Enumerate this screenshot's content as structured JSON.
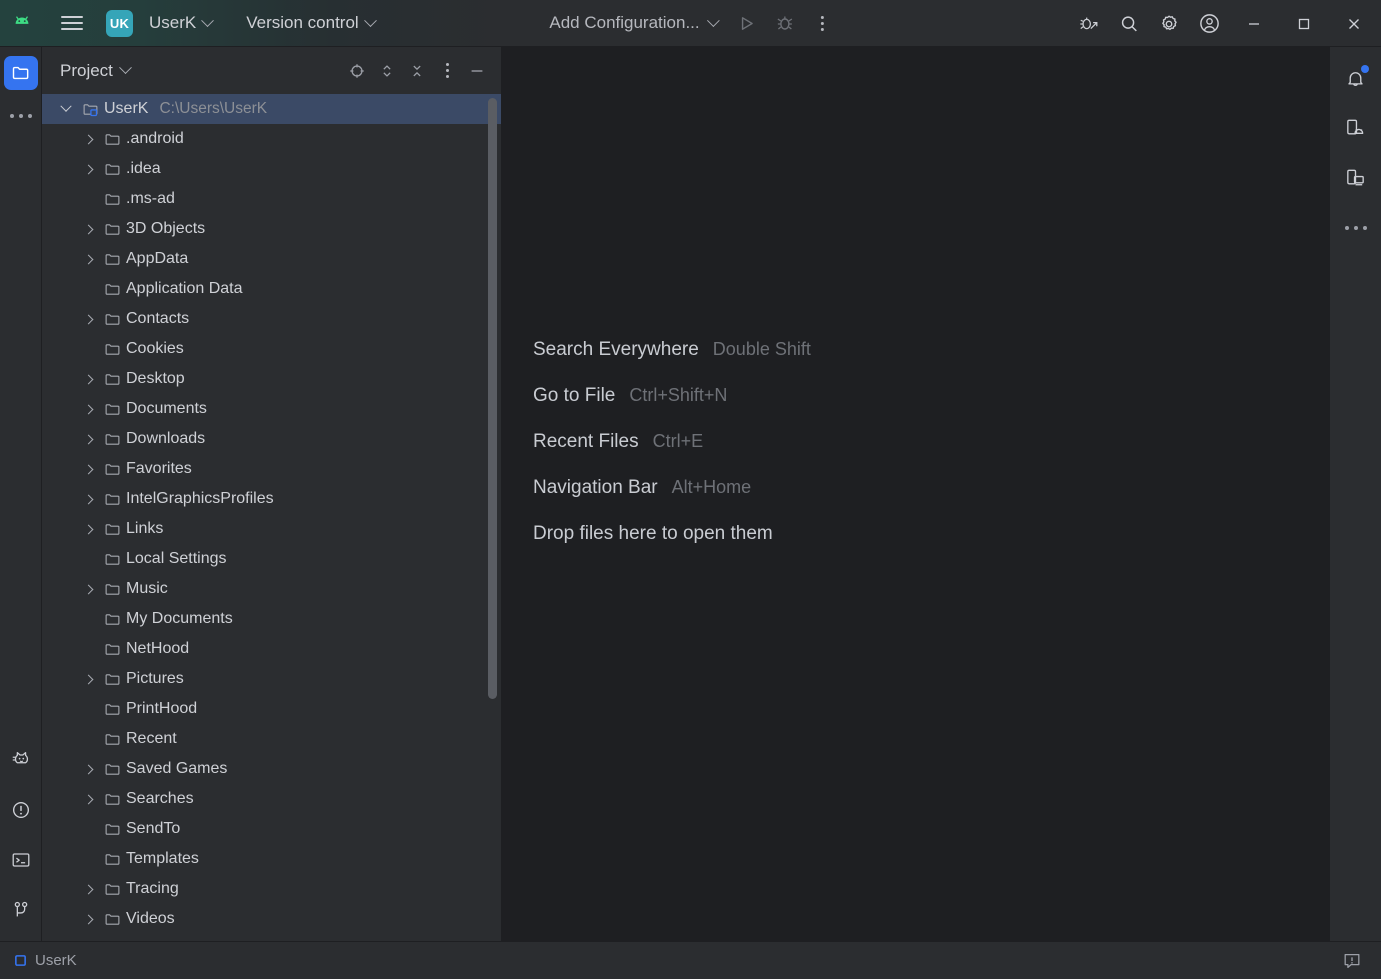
{
  "colors": {
    "accent_blue": "#3574F0",
    "selection_blue": "#3B4A66",
    "badge_teal": "#35A5B8",
    "panel_bg": "#2B2D30",
    "editor_bg": "#1E1F22",
    "text_primary": "#CFD1D6",
    "text_muted": "#8D9096",
    "android_green": "#3DDC84"
  },
  "titlebar": {
    "logo_icon": "android-studio-logo-icon",
    "menu_icon": "hamburger-menu-icon",
    "project_badge": "UK",
    "project_name": "UserK",
    "project_chevron_icon": "chevron-down-icon",
    "vcs_label": "Version control",
    "vcs_chevron_icon": "chevron-down-icon",
    "run_config_label": "Add Configuration...",
    "run_config_chevron_icon": "chevron-down-icon",
    "run_icon": "run-play-icon",
    "debug_icon": "debug-bug-icon",
    "more_icon": "more-vertical-icon",
    "app_inspection_icon": "bug-with-arrow-icon",
    "search_icon": "search-icon",
    "settings_icon": "gear-icon",
    "account_icon": "user-avatar-icon",
    "minimize_icon": "window-minimize-icon",
    "maximize_icon": "window-maximize-icon",
    "close_icon": "window-close-icon"
  },
  "left_stripe": {
    "top_items": [
      {
        "name": "project",
        "icon": "folder-icon",
        "active": true
      },
      {
        "name": "more",
        "icon": "more-horizontal-icon",
        "active": false
      }
    ],
    "bottom_items": [
      {
        "name": "logcat",
        "icon": "cat-logcat-icon"
      },
      {
        "name": "problems",
        "icon": "problems-warning-icon"
      },
      {
        "name": "terminal",
        "icon": "terminal-icon"
      },
      {
        "name": "version-control",
        "icon": "branch-icon"
      }
    ]
  },
  "right_stripe": {
    "items": [
      {
        "name": "notifications",
        "icon": "bell-icon",
        "badge": true
      },
      {
        "name": "device-manager",
        "icon": "device-manager-icon",
        "badge": false
      },
      {
        "name": "running-devices",
        "icon": "running-devices-icon",
        "badge": false
      },
      {
        "name": "more",
        "icon": "more-horizontal-icon",
        "badge": false
      }
    ]
  },
  "project_panel": {
    "title": "Project",
    "title_chevron_icon": "chevron-down-icon",
    "actions": [
      {
        "name": "select-opened-file",
        "icon": "crosshair-target-icon"
      },
      {
        "name": "expand-collapse",
        "icon": "chevron-up-down-icon"
      },
      {
        "name": "collapse-all",
        "icon": "collapse-all-icon"
      },
      {
        "name": "options",
        "icon": "more-vertical-icon"
      },
      {
        "name": "hide",
        "icon": "minimize-dash-icon"
      }
    ],
    "root": {
      "label": "UserK",
      "path": "C:\\Users\\UserK",
      "icon": "module-folder-icon",
      "expanded": true,
      "selected": true
    },
    "children": [
      {
        "label": ".android",
        "expandable": true
      },
      {
        "label": ".idea",
        "expandable": true
      },
      {
        "label": ".ms-ad",
        "expandable": false
      },
      {
        "label": "3D Objects",
        "expandable": true
      },
      {
        "label": "AppData",
        "expandable": true
      },
      {
        "label": "Application Data",
        "expandable": false
      },
      {
        "label": "Contacts",
        "expandable": true
      },
      {
        "label": "Cookies",
        "expandable": false
      },
      {
        "label": "Desktop",
        "expandable": true
      },
      {
        "label": "Documents",
        "expandable": true
      },
      {
        "label": "Downloads",
        "expandable": true
      },
      {
        "label": "Favorites",
        "expandable": true
      },
      {
        "label": "IntelGraphicsProfiles",
        "expandable": true
      },
      {
        "label": "Links",
        "expandable": true
      },
      {
        "label": "Local Settings",
        "expandable": false
      },
      {
        "label": "Music",
        "expandable": true
      },
      {
        "label": "My Documents",
        "expandable": false
      },
      {
        "label": "NetHood",
        "expandable": false
      },
      {
        "label": "Pictures",
        "expandable": true
      },
      {
        "label": "PrintHood",
        "expandable": false
      },
      {
        "label": "Recent",
        "expandable": false
      },
      {
        "label": "Saved Games",
        "expandable": true
      },
      {
        "label": "Searches",
        "expandable": true
      },
      {
        "label": "SendTo",
        "expandable": false
      },
      {
        "label": "Templates",
        "expandable": false
      },
      {
        "label": "Tracing",
        "expandable": true
      },
      {
        "label": "Videos",
        "expandable": true
      }
    ]
  },
  "editor": {
    "empty_actions": [
      {
        "name": "Search Everywhere",
        "shortcut": "Double Shift"
      },
      {
        "name": "Go to File",
        "shortcut": "Ctrl+Shift+N"
      },
      {
        "name": "Recent Files",
        "shortcut": "Ctrl+E"
      },
      {
        "name": "Navigation Bar",
        "shortcut": "Alt+Home"
      }
    ],
    "drop_hint": "Drop files here to open them"
  },
  "statusbar": {
    "project_icon": "project-square-icon",
    "project_label": "UserK",
    "notification_icon": "event-log-bubble-icon"
  }
}
